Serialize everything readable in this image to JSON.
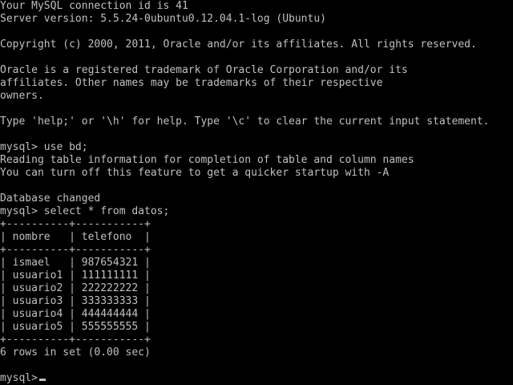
{
  "terminal": {
    "background": "#000000",
    "foreground": "#c0c0c0",
    "lines": [
      "Your MySQL connection id is 41",
      "Server version: 5.5.24-0ubuntu0.12.04.1-log (Ubuntu)",
      "",
      "Copyright (c) 2000, 2011, Oracle and/or its affiliates. All rights reserved.",
      "",
      "Oracle is a registered trademark of Oracle Corporation and/or its",
      "affiliates. Other names may be trademarks of their respective",
      "owners.",
      "",
      "Type 'help;' or '\\h' for help. Type '\\c' to clear the current input statement.",
      "",
      "mysql> use bd;",
      "Reading table information for completion of table and column names",
      "You can turn off this feature to get a quicker startup with -A",
      "",
      "Database changed",
      "mysql> select * from datos;",
      "+----------+-----------+",
      "| nombre   | telefono  |",
      "+----------+-----------+",
      "| ismael   | 987654321 |",
      "| usuario1 | 111111111 |",
      "| usuario2 | 222222222 |",
      "| usuario3 | 333333333 |",
      "| usuario4 | 444444444 |",
      "| usuario5 | 555555555 |",
      "+----------+-----------+",
      "6 rows in set (0.00 sec)",
      ""
    ],
    "prompt": "mysql>"
  }
}
